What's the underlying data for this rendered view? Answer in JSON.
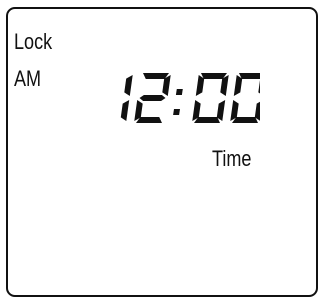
{
  "display": {
    "lock_label": "Lock",
    "period_label": "AM",
    "time_value": "12:00",
    "field_label": "Time",
    "segment_color": "#111111",
    "background_color": "#ffffff"
  }
}
